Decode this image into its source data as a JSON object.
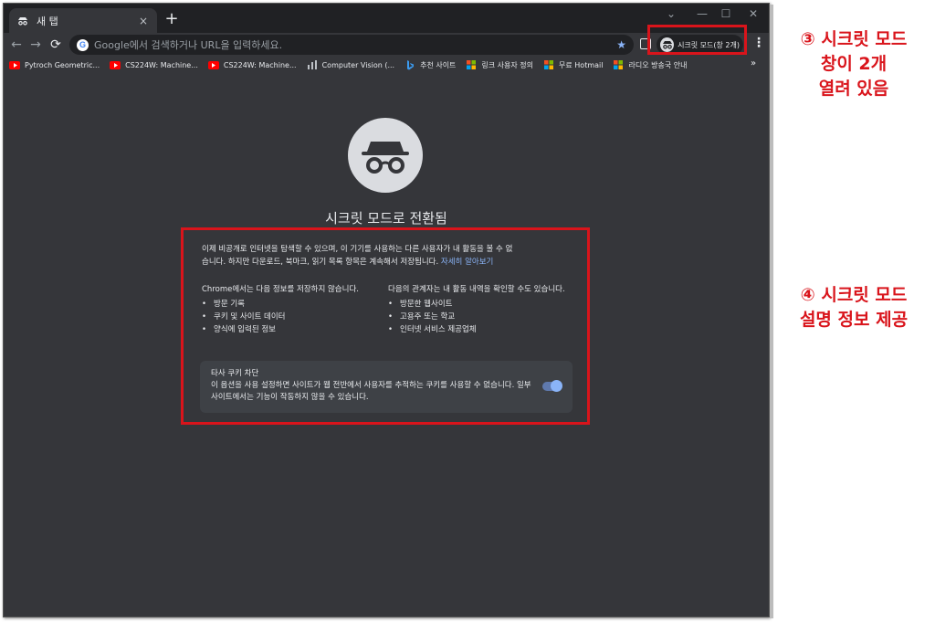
{
  "tab": {
    "title": "새 탭",
    "close": "×",
    "new_tab": "+"
  },
  "window_controls": {
    "chevron": "⌄",
    "minimize": "—",
    "maximize": "☐",
    "close": "✕"
  },
  "toolbar": {
    "back": "←",
    "forward": "→",
    "reload": "⟳",
    "google_letter": "G",
    "omnibox_placeholder": "Google에서 검색하거나 URL을 입력하세요.",
    "star": "★",
    "incognito_label": "시크릿 모드(창 2개)",
    "menu": "⋮"
  },
  "bookmarks": [
    {
      "label": "Pytroch Geometric...",
      "icon": "youtube-icon",
      "color": "#ff0000"
    },
    {
      "label": "CS224W: Machine...",
      "icon": "youtube-icon",
      "color": "#ff0000"
    },
    {
      "label": "CS224W: Machine...",
      "icon": "youtube-icon",
      "color": "#ff0000"
    },
    {
      "label": "Computer Vision (...",
      "icon": "chart-icon",
      "color": "#5f6368"
    },
    {
      "label": "추천 사이트",
      "icon": "bing-icon",
      "color": "#3b82f6"
    },
    {
      "label": "링크 사용자 정의",
      "icon": "windows-icon",
      "color": "#f25022"
    },
    {
      "label": "무료 Hotmail",
      "icon": "windows-icon",
      "color": "#f25022"
    },
    {
      "label": "라디오 방송국 안내",
      "icon": "windows-icon",
      "color": "#f25022"
    }
  ],
  "bookmarks_more": "»",
  "incognito_page": {
    "headline": "시크릿 모드로 전환됨",
    "intro_line1": "이제 비공개로 인터넷을 탐색할 수 있으며, 이 기기를 사용하는 다른 사용자가 내 활동을 볼 수 없",
    "intro_line2": "습니다. 하지만 다운로드, 북마크, 읽기 목록 항목은 계속해서 저장됩니다.",
    "learn_more": "자세히 알아보기",
    "left_heading": "Chrome에서는 다음 정보를 저장하지 않습니다.",
    "left_items": [
      "방문 기록",
      "쿠키 및 사이트 데이터",
      "양식에 입력된 정보"
    ],
    "right_heading": "다음의 관계자는 내 활동 내역을 확인할 수도 있습니다.",
    "right_items": [
      "방문한 웹사이트",
      "고용주 또는 학교",
      "인터넷 서비스 제공업체"
    ],
    "cookie_title": "타사 쿠키 차단",
    "cookie_desc": "이 옵션을 사용 설정하면 사이트가 웹 전반에서 사용자를 추적하는 쿠키를 사용할 수 없습니다. 일부 사이트에서는 기능이 작동하지 않을 수 있습니다.",
    "cookie_toggle_on": true
  },
  "annotations": {
    "a3_line1": "③ 시크릿 모드",
    "a3_line2": "창이 2개",
    "a3_line3": "열려 있음",
    "a4_line1": "④ 시크릿 모드",
    "a4_line2": "설명 정보 제공",
    "highlight_color": "#d9141b"
  }
}
